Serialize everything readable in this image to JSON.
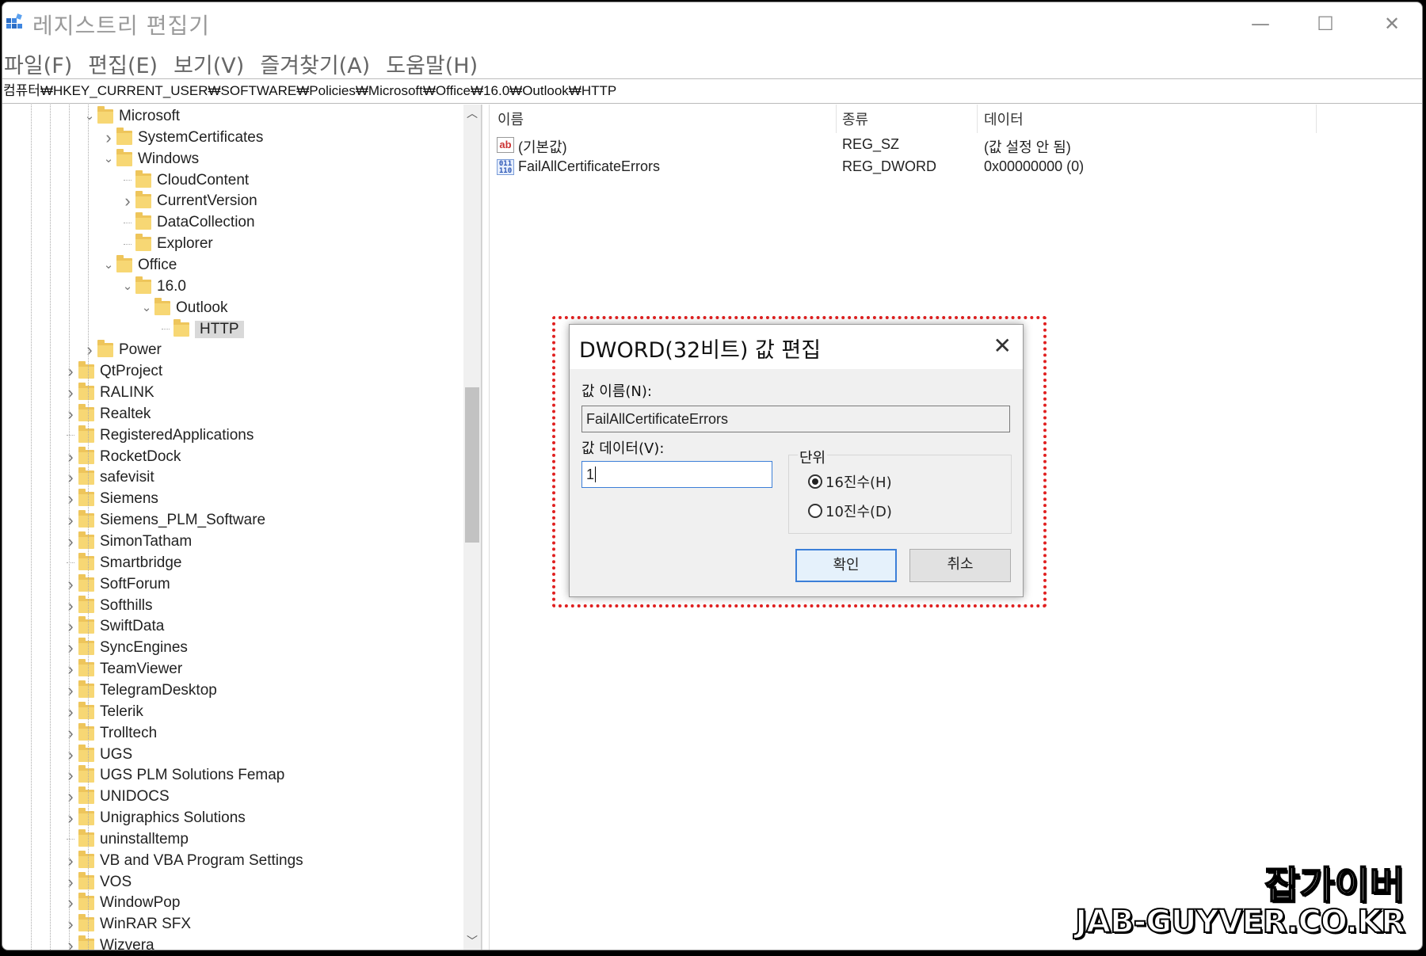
{
  "window": {
    "title": "레지스트리 편집기",
    "minimize": "—",
    "maximize": "☐",
    "close": "✕"
  },
  "menu": [
    "파일(F)",
    "편집(E)",
    "보기(V)",
    "즐겨찾기(A)",
    "도움말(H)"
  ],
  "address": "컴퓨터₩HKEY_CURRENT_USER₩SOFTWARE₩Policies₩Microsoft₩Office₩16.0₩Outlook₩HTTP",
  "tree": [
    {
      "label": "Microsoft",
      "level": 2,
      "expander": "open"
    },
    {
      "label": "SystemCertificates",
      "level": 3,
      "expander": "closed"
    },
    {
      "label": "Windows",
      "level": 3,
      "expander": "open"
    },
    {
      "label": "CloudContent",
      "level": 4,
      "expander": "none"
    },
    {
      "label": "CurrentVersion",
      "level": 4,
      "expander": "closed"
    },
    {
      "label": "DataCollection",
      "level": 4,
      "expander": "none"
    },
    {
      "label": "Explorer",
      "level": 4,
      "expander": "none"
    },
    {
      "label": "Office",
      "level": 3,
      "expander": "open"
    },
    {
      "label": "16.0",
      "level": 4,
      "expander": "open"
    },
    {
      "label": "Outlook",
      "level": 5,
      "expander": "open"
    },
    {
      "label": "HTTP",
      "level": 6,
      "expander": "none",
      "selected": true
    },
    {
      "label": "Power",
      "level": 2,
      "expander": "closed"
    },
    {
      "label": "QtProject",
      "level": 1,
      "expander": "closed"
    },
    {
      "label": "RALINK",
      "level": 1,
      "expander": "closed"
    },
    {
      "label": "Realtek",
      "level": 1,
      "expander": "closed"
    },
    {
      "label": "RegisteredApplications",
      "level": 1,
      "expander": "none"
    },
    {
      "label": "RocketDock",
      "level": 1,
      "expander": "closed"
    },
    {
      "label": "safevisit",
      "level": 1,
      "expander": "closed"
    },
    {
      "label": "Siemens",
      "level": 1,
      "expander": "closed"
    },
    {
      "label": "Siemens_PLM_Software",
      "level": 1,
      "expander": "closed"
    },
    {
      "label": "SimonTatham",
      "level": 1,
      "expander": "closed"
    },
    {
      "label": "Smartbridge",
      "level": 1,
      "expander": "none"
    },
    {
      "label": "SoftForum",
      "level": 1,
      "expander": "closed"
    },
    {
      "label": "Softhills",
      "level": 1,
      "expander": "closed"
    },
    {
      "label": "SwiftData",
      "level": 1,
      "expander": "closed"
    },
    {
      "label": "SyncEngines",
      "level": 1,
      "expander": "closed"
    },
    {
      "label": "TeamViewer",
      "level": 1,
      "expander": "closed"
    },
    {
      "label": "TelegramDesktop",
      "level": 1,
      "expander": "closed"
    },
    {
      "label": "Telerik",
      "level": 1,
      "expander": "closed"
    },
    {
      "label": "Trolltech",
      "level": 1,
      "expander": "closed"
    },
    {
      "label": "UGS",
      "level": 1,
      "expander": "closed"
    },
    {
      "label": "UGS PLM Solutions Femap",
      "level": 1,
      "expander": "closed"
    },
    {
      "label": "UNIDOCS",
      "level": 1,
      "expander": "closed"
    },
    {
      "label": "Unigraphics Solutions",
      "level": 1,
      "expander": "closed"
    },
    {
      "label": "uninstalltemp",
      "level": 1,
      "expander": "none"
    },
    {
      "label": "VB and VBA Program Settings",
      "level": 1,
      "expander": "closed"
    },
    {
      "label": "VOS",
      "level": 1,
      "expander": "closed"
    },
    {
      "label": "WindowPop",
      "level": 1,
      "expander": "closed"
    },
    {
      "label": "WinRAR SFX",
      "level": 1,
      "expander": "closed"
    },
    {
      "label": "Wizvera",
      "level": 1,
      "expander": "closed"
    }
  ],
  "list": {
    "headers": {
      "name": "이름",
      "type": "종류",
      "data": "데이터"
    },
    "rows": [
      {
        "icon": "string-value-icon",
        "name": "(기본값)",
        "type": "REG_SZ",
        "data": "(값 설정 안 됨)"
      },
      {
        "icon": "binary-value-icon",
        "name": "FailAllCertificateErrors",
        "type": "REG_DWORD",
        "data": "0x00000000 (0)"
      }
    ]
  },
  "dialog": {
    "title": "DWORD(32비트) 값 편집",
    "close": "✕",
    "name_label": "값 이름(N):",
    "name_value": "FailAllCertificateErrors",
    "data_label": "값 데이터(V):",
    "data_value": "1",
    "base_label": "단위",
    "base_hex": "16진수(H)",
    "base_dec": "10진수(D)",
    "base_selected": "hex",
    "ok": "확인",
    "cancel": "취소"
  },
  "watermark": {
    "line1": "잡가이버",
    "line2": "JAB-GUYVER.CO.KR"
  }
}
